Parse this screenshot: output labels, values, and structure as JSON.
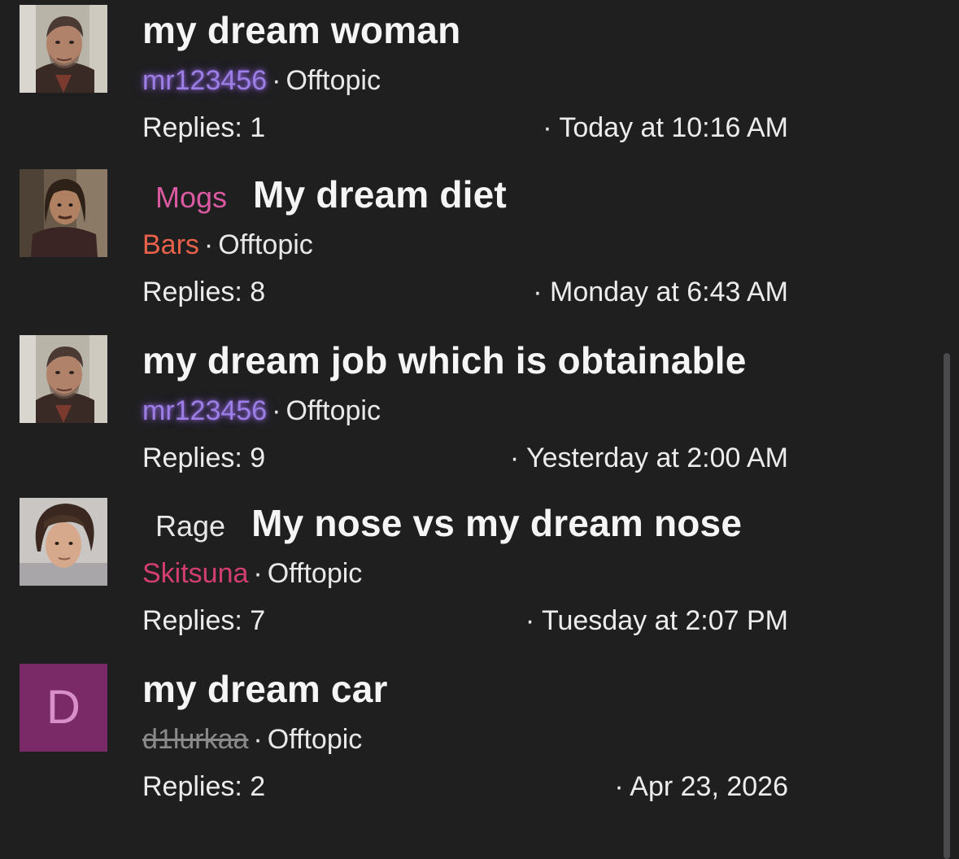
{
  "threads": [
    {
      "prefix": "",
      "prefix_color": "",
      "title": "my dream woman",
      "author": "mr123456",
      "forum": "Offtopic",
      "replies": "Replies: 1",
      "date": "· Today at 10:16 AM",
      "avatar": "profile-photo"
    },
    {
      "prefix": "Mogs",
      "prefix_color": "#d95aa0",
      "title": "My dream diet",
      "author": "Bars",
      "forum": "Offtopic",
      "replies": "Replies: 8",
      "date": "· Monday at 6:43 AM",
      "avatar": "profile-photo"
    },
    {
      "prefix": "",
      "prefix_color": "",
      "title": "my dream job which is obtainable",
      "author": "mr123456",
      "forum": "Offtopic",
      "replies": "Replies: 9",
      "date": "· Yesterday at 2:00 AM",
      "avatar": "profile-photo"
    },
    {
      "prefix": "Rage",
      "prefix_color": "#e6e6e6",
      "title": "My nose vs my dream nose",
      "author": "Skitsuna",
      "forum": "Offtopic",
      "replies": "Replies: 7",
      "date": "· Tuesday at 2:07 PM",
      "avatar": "profile-photo"
    },
    {
      "prefix": "",
      "prefix_color": "",
      "title": "my dream car",
      "author": "d1lurkaa",
      "forum": "Offtopic",
      "replies": "Replies: 2",
      "date": "· Apr 23, 2026",
      "avatar_letter": "D",
      "avatar_color": "#7a2a67"
    }
  ],
  "separator": "·"
}
